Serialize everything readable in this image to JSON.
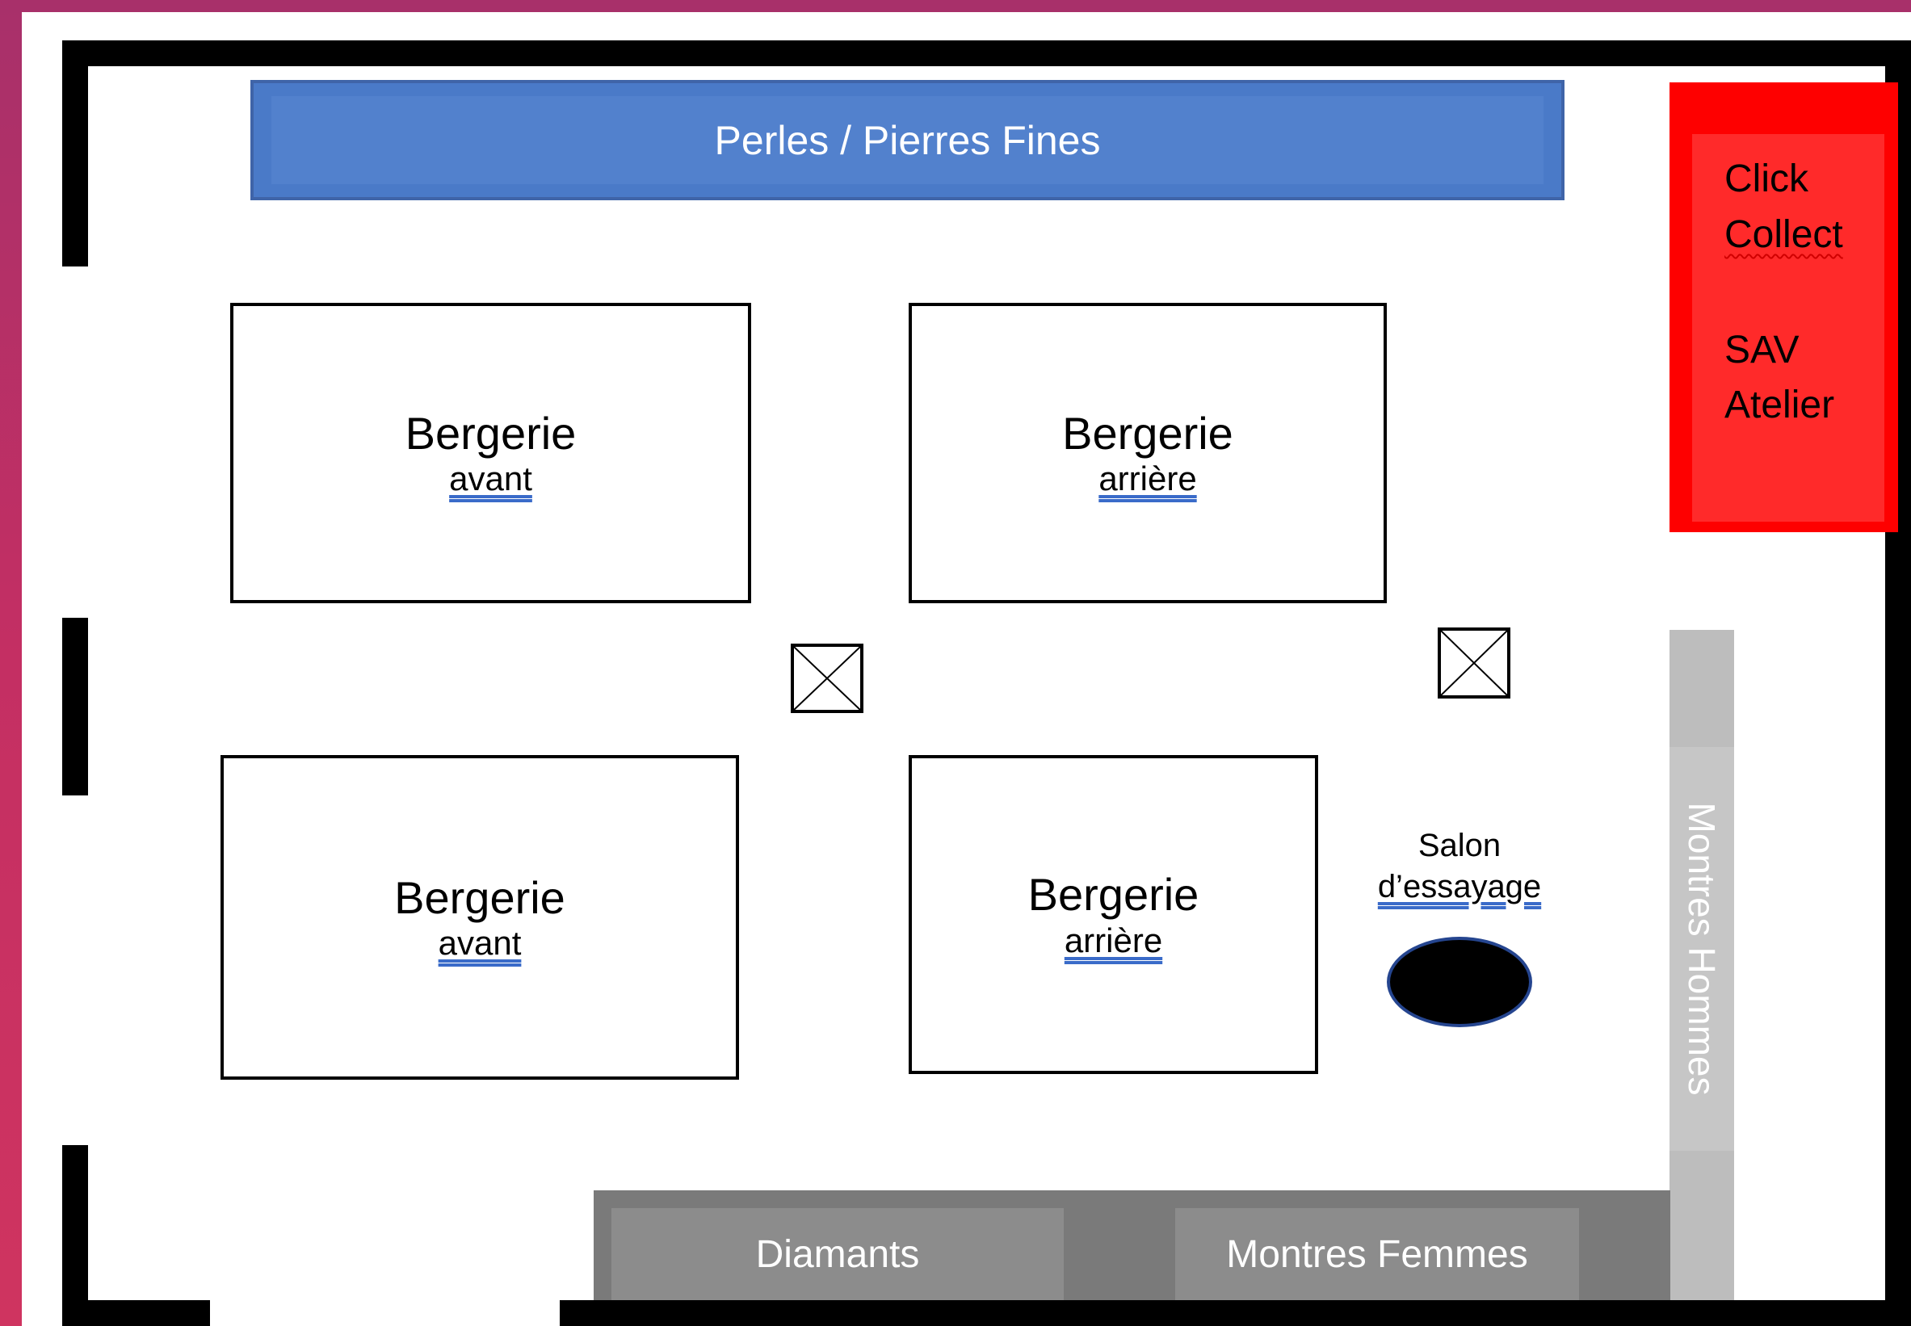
{
  "floor_plan": {
    "perles_label": "Perles / Pierres Fines",
    "click_collect": {
      "line1": "Click",
      "line2": "Collect",
      "line3": "SAV",
      "line4": "Atelier"
    },
    "tables": [
      {
        "title": "Bergerie",
        "subtitle": "avant"
      },
      {
        "title": "Bergerie",
        "subtitle": "arrière"
      },
      {
        "title": "Bergerie",
        "subtitle": "avant"
      },
      {
        "title": "Bergerie",
        "subtitle": "arrière"
      }
    ],
    "salon": {
      "line1": "Salon",
      "line2": "d’essayage"
    },
    "montres_hommes_label": "Montres Hommes",
    "diamants_label": "Diamants",
    "montres_femmes_label": "Montres Femmes"
  },
  "colors": {
    "background": "#c42f63",
    "perles_blue": "#4a7ac8",
    "click_collect_red": "#fe0000",
    "montres_hommes_gray": "#bdbdbd",
    "bottom_band_gray": "#7a7a7a",
    "wall": "#000000"
  }
}
